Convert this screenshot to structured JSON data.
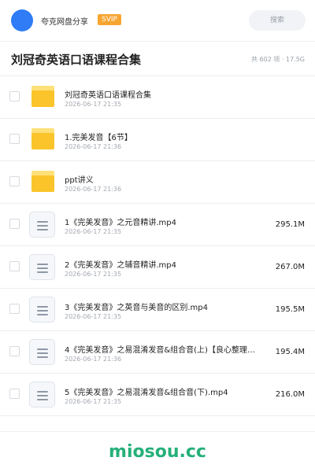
{
  "header": {
    "brand": "夸克网盘分享",
    "badge": "SVIP",
    "search_placeholder": "搜索"
  },
  "share": {
    "title": "刘冠奇英语口语课程合集",
    "summary": "共 602 项 · 17.5G"
  },
  "files": [
    {
      "type": "folder",
      "name": "刘冠奇英语口语课程合集",
      "date": "2026-06-17 21:35",
      "size": ""
    },
    {
      "type": "folder",
      "name": "1.完美发音【6节】",
      "date": "2026-06-17 21:36",
      "size": ""
    },
    {
      "type": "folder",
      "name": "ppt讲义",
      "date": "2026-06-17 21:36",
      "size": ""
    },
    {
      "type": "video",
      "name": "1《完美发音》之元音精讲.mp4",
      "date": "2026-06-17 21:35",
      "size": "295.1M"
    },
    {
      "type": "video",
      "name": "2《完美发音》之辅音精讲.mp4",
      "date": "2026-06-17 21:35",
      "size": "267.0M"
    },
    {
      "type": "video",
      "name": "3《完美发音》之英音与美音的区别.mp4",
      "date": "2026-06-17 21:35",
      "size": "195.5M"
    },
    {
      "type": "video",
      "name": "4《完美发音》之易混淆发音&组合音(上)【良心整理…",
      "date": "2026-06-17 21:36",
      "size": "195.4M"
    },
    {
      "type": "video",
      "name": "5《完美发音》之易混淆发音&组合音(下).mp4",
      "date": "2026-06-17 21:35",
      "size": "216.0M"
    }
  ],
  "footer": {
    "watermark": "miosou.cc"
  },
  "icons": {
    "avatar": "user-avatar-icon",
    "folder": "folder-icon",
    "video": "document-icon"
  },
  "colors": {
    "avatar": "#2f7cf6",
    "badge": "#f7a531",
    "folder": "#fbc42a",
    "watermark": "#25b07a"
  }
}
